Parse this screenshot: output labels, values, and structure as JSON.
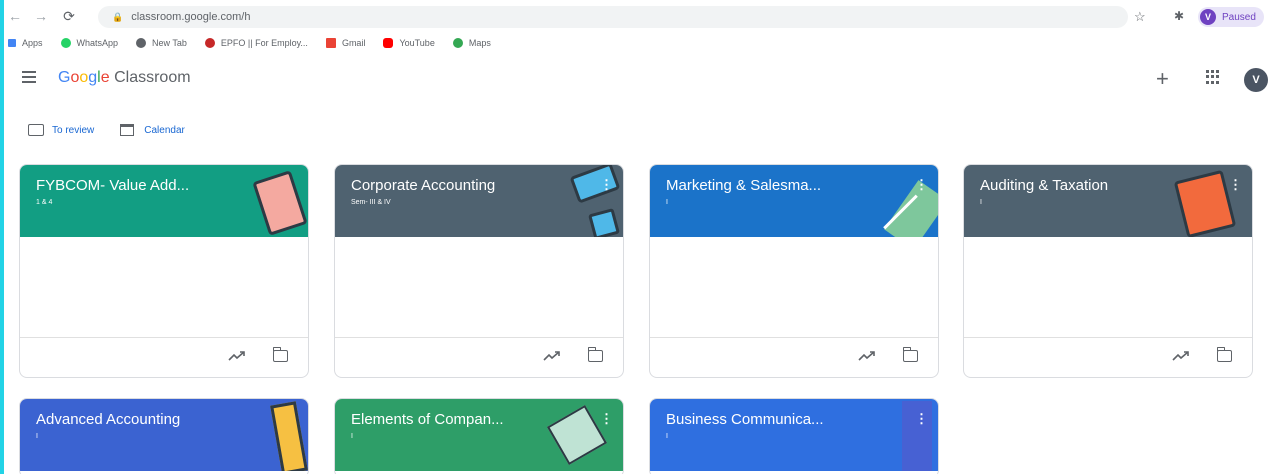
{
  "browser": {
    "url": "classroom.google.com/h",
    "profile_initial": "V",
    "profile_status": "Paused",
    "bookmarks": [
      {
        "label": "Apps",
        "color": "#4285f4"
      },
      {
        "label": "WhatsApp",
        "color": "#25d366"
      },
      {
        "label": "New Tab",
        "color": "#5f6368"
      },
      {
        "label": "EPFO || For Employ...",
        "color": "#c62828"
      },
      {
        "label": "Gmail",
        "color": "#ea4335"
      },
      {
        "label": "YouTube",
        "color": "#ff0000"
      },
      {
        "label": "Maps",
        "color": "#34a853"
      }
    ]
  },
  "header": {
    "logo_google": [
      "G",
      "o",
      "o",
      "g",
      "l",
      "e"
    ],
    "logo_product": " Classroom",
    "avatar_initial": "V"
  },
  "actions": {
    "to_review": "To review",
    "calendar": "Calendar"
  },
  "cards": [
    {
      "title": "FYBCOM- Value Add...",
      "subtitle": "1 & 4",
      "color": "#129e83",
      "icon": "clipboard-illustration"
    },
    {
      "title": "Corporate Accounting",
      "subtitle": "Sem- III & IV",
      "color": "#4f6270",
      "icon": "tablet-illustration"
    },
    {
      "title": "Marketing & Salesma...",
      "subtitle": "I",
      "color": "#1b73c9",
      "icon": "pencil-illustration"
    },
    {
      "title": "Auditing & Taxation",
      "subtitle": "I",
      "color": "#4f6270",
      "icon": "book-illustration"
    },
    {
      "title": "Advanced Accounting",
      "subtitle": "I",
      "color": "#3b63d1",
      "icon": "notebook-illustration"
    },
    {
      "title": "Elements of Compan...",
      "subtitle": "I",
      "color": "#2e9e68",
      "icon": "notebook-illustration"
    },
    {
      "title": "Business Communica...",
      "subtitle": "I",
      "color": "#2f6fe0",
      "icon": "pattern-illustration"
    }
  ]
}
